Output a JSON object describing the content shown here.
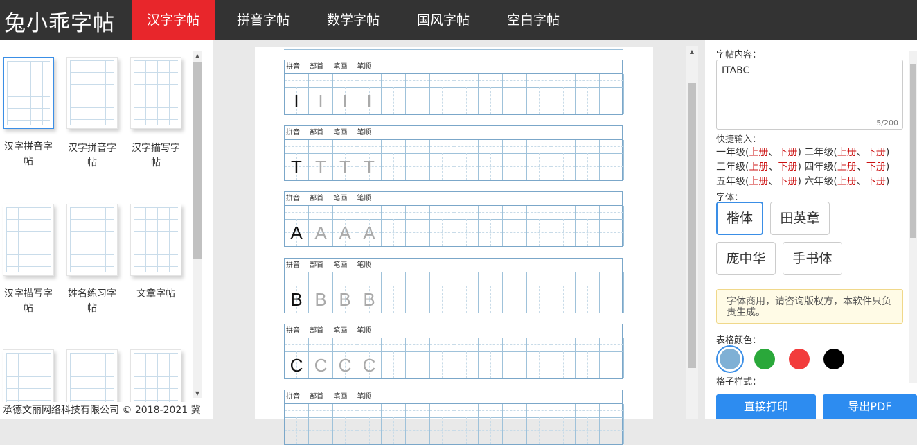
{
  "app": {
    "logo": "兔小乖字帖"
  },
  "nav": {
    "tabs": [
      "汉字字帖",
      "拼音字帖",
      "数学字帖",
      "国风字帖",
      "空白字帖"
    ],
    "active": "汉字字帖"
  },
  "templates": {
    "row1": [
      "汉字拼音字帖",
      "汉字拼音字帖",
      "汉字描写字帖"
    ],
    "row2": [
      "汉字描写字帖",
      "姓名练习字帖",
      "文章字帖"
    ]
  },
  "footer": {
    "text": "承德文丽网络科技有限公司 © 2018-2021 冀"
  },
  "sheet": {
    "header_labels": [
      "拼音",
      "部首",
      "笔画",
      "笔顺"
    ],
    "rows": [
      {
        "char": "I"
      },
      {
        "char": "T"
      },
      {
        "char": "A"
      },
      {
        "char": "B"
      },
      {
        "char": "C"
      },
      {
        "char": ""
      }
    ]
  },
  "settings": {
    "content_label": "字帖内容：",
    "content_value": "ITABC",
    "char_count": "5/200",
    "quick_label": "快捷输入：",
    "quick": [
      {
        "g1": "一年级",
        "u1": "上册",
        "d1": "下册",
        "g2": "二年级",
        "u2": "上册",
        "d2": "下册"
      },
      {
        "g1": "三年级",
        "u1": "上册",
        "d1": "下册",
        "g2": "四年级",
        "u2": "上册",
        "d2": "下册"
      },
      {
        "g1": "五年级",
        "u1": "上册",
        "d1": "下册",
        "g2": "六年级",
        "u2": "上册",
        "d2": "下册"
      }
    ],
    "font_label": "字体：",
    "fonts": [
      "楷体",
      "田英章",
      "庞中华",
      "手书体"
    ],
    "selected_font": "楷体",
    "font_notice": "字体商用，请咨询版权方，本软件只负责生成。",
    "grid_color_label": "表格颜色：",
    "grid_colors": [
      "#7fb0d5",
      "#2aa83a",
      "#f23c3c",
      "#000000"
    ],
    "selected_color": "#7fb0d5",
    "cell_style_label": "格子样式：",
    "print_button": "直接打印",
    "export_button": "导出PDF"
  }
}
